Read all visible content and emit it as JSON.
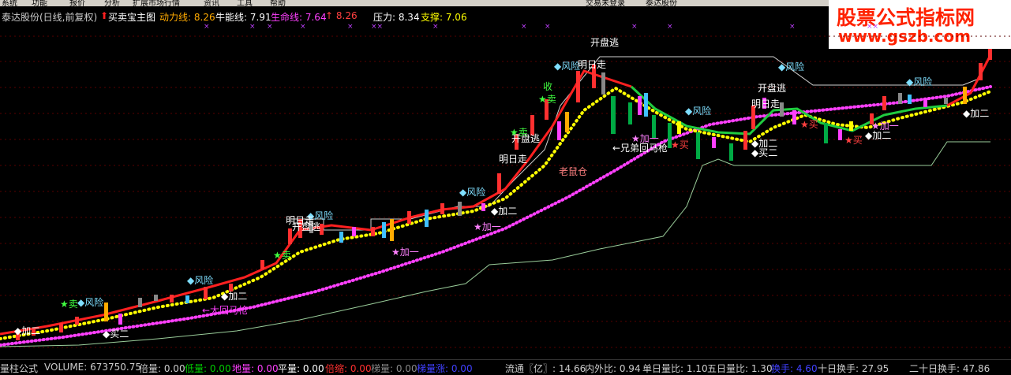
{
  "menu": [
    "系统",
    "功能",
    "报价",
    "分析",
    "扩展市场行情",
    "资讯",
    "工具",
    "帮助",
    "交易未登录",
    "泰达股份"
  ],
  "header": {
    "stock": "泰达股份(日线,前复权)",
    "indicator_arrow_color": "#ff2020",
    "indicator": "买卖宝主图",
    "items": [
      {
        "text": "动力线: 8.26",
        "color": "#ffaa00"
      },
      {
        "text": "牛能线: 7.91",
        "color": "#ffffff"
      },
      {
        "text": "生命线: 7.64",
        "color": "#ff40ff"
      },
      {
        "text": "↑ 8.26",
        "color": "#ff4040"
      },
      {
        "text": "压力: 8.34",
        "color": "#ffffff"
      },
      {
        "text": "支撑: 7.06",
        "color": "#ffff00"
      }
    ]
  },
  "watermark": {
    "line1": "股票公式指标网",
    "line2": "www.gszb.com"
  },
  "status": {
    "left": [
      {
        "text": "量柱公式",
        "color": "#cccccc"
      },
      {
        "text": "VOLUME: 673750.75",
        "color": "#cccccc"
      },
      {
        "text": "倍量: 0.00",
        "color": "#cccccc"
      },
      {
        "text": "低量: 0.00",
        "color": "#00cc00"
      },
      {
        "text": "地量: 0.00",
        "color": "#ff40ff"
      },
      {
        "text": "平量: 0.00",
        "color": "#ffffff"
      },
      {
        "text": "倍缩: 0.00",
        "color": "#ff3030"
      },
      {
        "text": "梯量: 0.00",
        "color": "#888888"
      },
      {
        "text": "梯量涨: 0.00",
        "color": "#4040ff"
      }
    ],
    "right": [
      {
        "text": "流通〖亿〗: 14.66",
        "color": "#cccccc"
      },
      {
        "text": "内外比: 0.94",
        "color": "#cccccc"
      },
      {
        "text": "单日量比: 1.10",
        "color": "#cccccc"
      },
      {
        "text": "五日量比: 1.30",
        "color": "#cccccc"
      },
      {
        "text": "换手: 4.60",
        "color": "#4040ff"
      },
      {
        "text": "十日换手: 27.95",
        "color": "#cccccc"
      },
      {
        "text": "二十日换手: 47.86",
        "color": "#cccccc"
      }
    ]
  },
  "annotations": {
    "fengxian": "◆风险",
    "jiaer": "◆加二",
    "mai": "★卖",
    "maiRed": "★买",
    "kaipan": "开盘逃",
    "mingri": "明日走",
    "laoshu": "老鼠仓",
    "xiongdi": "←兄弟回马枪",
    "dahui": "←大回马枪",
    "jiayi": "★加一",
    "shou": "收",
    "mai2": "◆买二"
  },
  "colors": {
    "up": "#ff3030",
    "down": "#00cc66",
    "support": "#ffff00",
    "life": "#ff40ff",
    "white": "#ffffff"
  }
}
